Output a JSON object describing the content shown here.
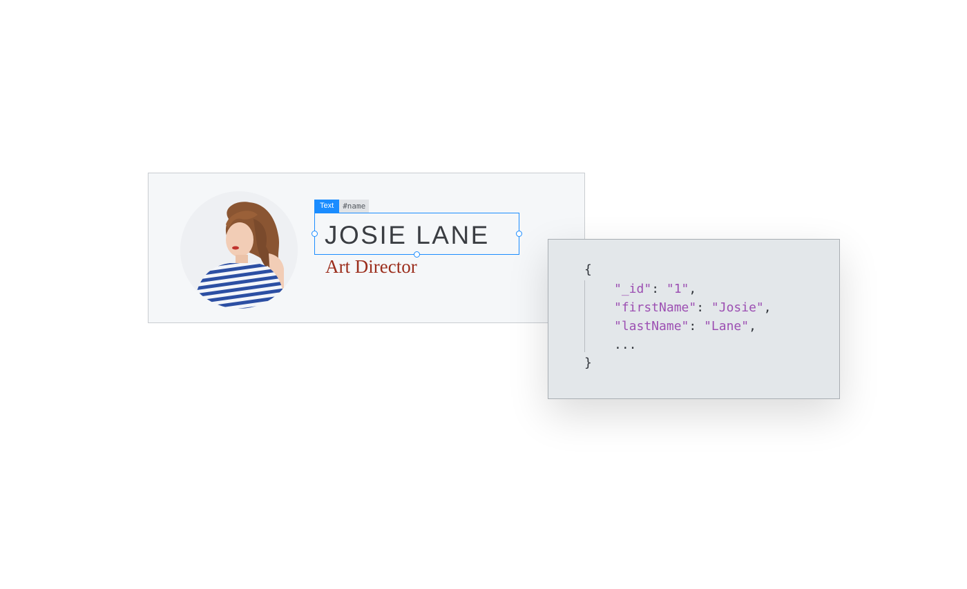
{
  "card": {
    "element_type": "Text",
    "element_id": "#name",
    "name": "JOSIE LANE",
    "title": "Art Director",
    "avatar_alt": "profile photo"
  },
  "json_panel": {
    "open_brace": "{",
    "close_brace": "}",
    "lines": [
      {
        "key": "\"_id\"",
        "value": "\"1\""
      },
      {
        "key": "\"firstName\"",
        "value": "\"Josie\""
      },
      {
        "key": "\"lastName\"",
        "value": "\"Lane\""
      }
    ],
    "ellipsis": "...",
    "colors": {
      "string": "#9c4fb2",
      "punctuation": "#2e3238"
    }
  },
  "colors": {
    "selection_accent": "#1a8cff",
    "name_text": "#3a3d42",
    "title_text": "#9b2d1c",
    "card_background": "#f5f7f9",
    "panel_background": "#e3e7ea"
  }
}
